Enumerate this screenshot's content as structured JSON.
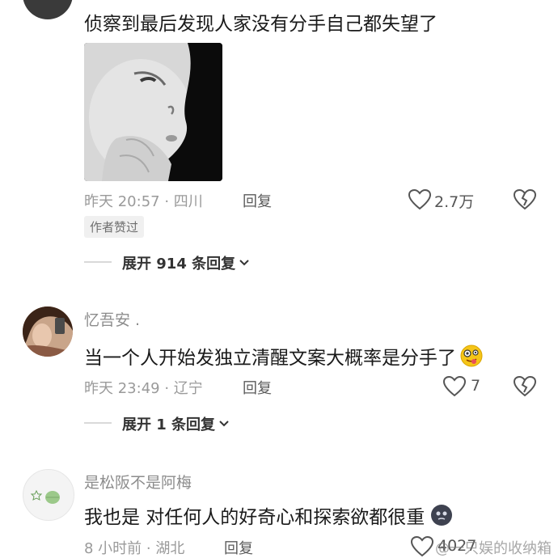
{
  "comments": [
    {
      "text": "侦察到最后发现人家没有分手自己都失望了",
      "time": "昨天 20:57",
      "location": "四川",
      "reply_label": "回复",
      "likes": "2.7万",
      "badge": "作者赞过",
      "expand": "展开 914 条回复"
    },
    {
      "username": "忆吾安 .",
      "text": "当一个人开始发独立清醒文案大概率是分手了",
      "time": "昨天 23:49",
      "location": "辽宁",
      "reply_label": "回复",
      "likes": "7",
      "expand": "展开 1 条回复"
    },
    {
      "username": "是松阪不是阿梅",
      "text": "我也是 对任何人的好奇心和探索欲都很重",
      "time": "8 小时前",
      "location": "湖北",
      "reply_label": "回复",
      "likes": "4027"
    }
  ],
  "watermark": "@一只娱的收纳箱",
  "icons": {
    "like": "heart-outline-icon",
    "dislike": "broken-heart-icon",
    "chevron": "chevron-down-icon",
    "emoji_silly": "silly-face-emoji-icon",
    "emoji_dark": "dark-face-emoji-icon"
  }
}
